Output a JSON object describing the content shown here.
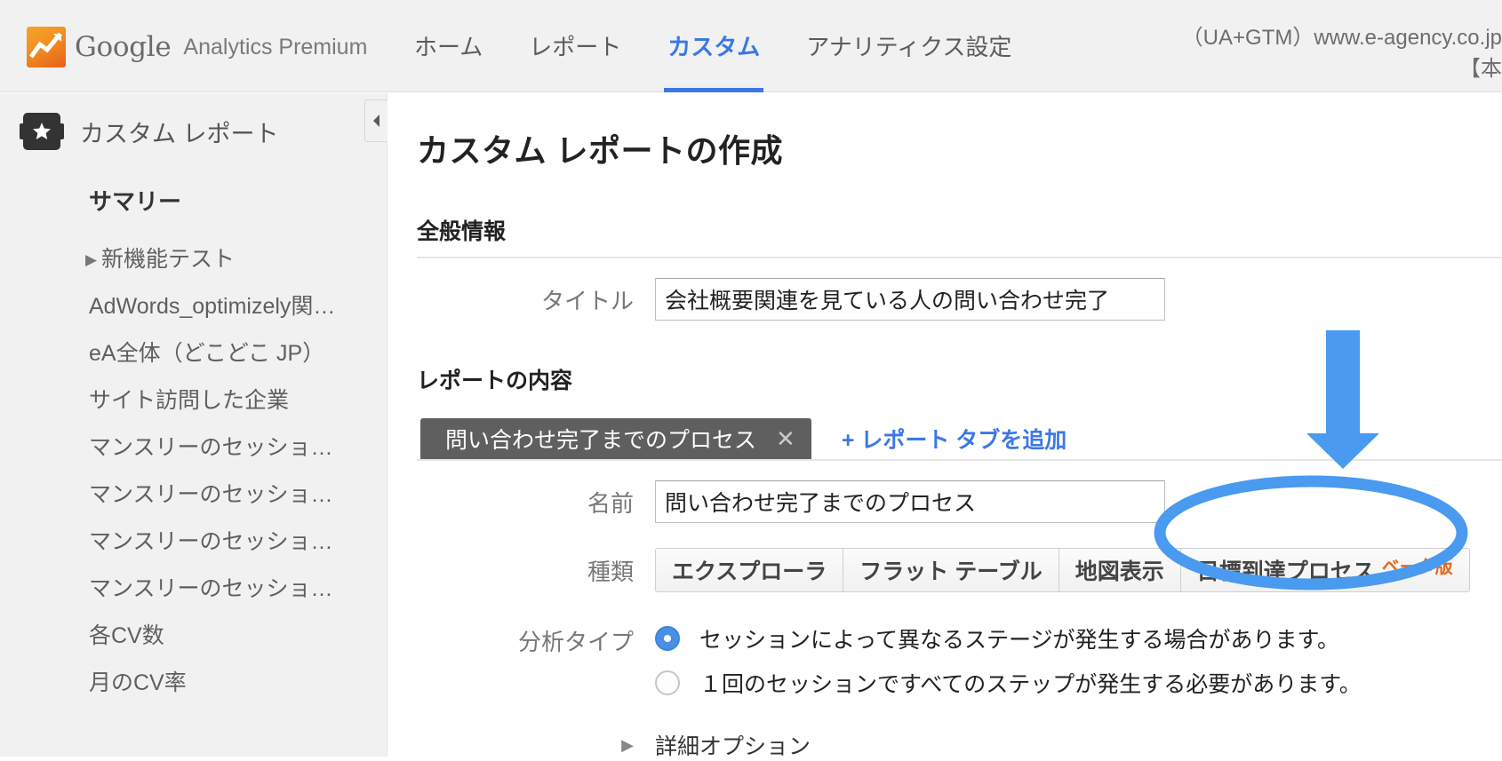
{
  "header": {
    "logo_word": "Google",
    "logo_sub": "Analytics Premium",
    "nav": [
      {
        "label": "ホーム",
        "active": false
      },
      {
        "label": "レポート",
        "active": false
      },
      {
        "label": "カスタム",
        "active": true
      },
      {
        "label": "アナリティクス設定",
        "active": false
      }
    ],
    "account_line1": "（UA+GTM）www.e-agency.co.jp",
    "account_line2": "【本"
  },
  "sidebar": {
    "title": "カスタム レポート",
    "summary_label": "サマリー",
    "items": [
      {
        "label": "新機能テスト",
        "caret": true
      },
      {
        "label": "AdWords_optimizely関…",
        "caret": false
      },
      {
        "label": "eA全体（どこどこ JP）",
        "caret": false
      },
      {
        "label": "サイト訪問した企業",
        "caret": false
      },
      {
        "label": "マンスリーのセッショ…",
        "caret": false
      },
      {
        "label": "マンスリーのセッショ…",
        "caret": false
      },
      {
        "label": "マンスリーのセッショ…",
        "caret": false
      },
      {
        "label": "マンスリーのセッショ…",
        "caret": false
      },
      {
        "label": "各CV数",
        "caret": false
      },
      {
        "label": "月のCV率",
        "caret": false
      }
    ]
  },
  "main": {
    "page_title": "カスタム レポートの作成",
    "general_section": {
      "heading": "全般情報",
      "title_label": "タイトル",
      "title_value": "会社概要関連を見ている人の問い合わせ完了",
      "title_placeholder": "タイトル"
    },
    "content_section": {
      "heading": "レポートの内容",
      "tab_label": "問い合わせ完了までのプロセス",
      "tab_close_glyph": "✕",
      "add_tab_label": "+ レポート タブを追加",
      "name_label": "名前",
      "name_value": "問い合わせ完了までのプロセス",
      "name_placeholder": "名前",
      "type_label": "種類",
      "type_buttons": [
        {
          "label": "エクスプローラ",
          "badge": ""
        },
        {
          "label": "フラット テーブル",
          "badge": ""
        },
        {
          "label": "地図表示",
          "badge": ""
        },
        {
          "label": "目標到達プロセス",
          "badge": "ベータ版"
        }
      ],
      "analysis_label": "分析タイプ",
      "analysis_options": [
        {
          "label": "セッションによって異なるステージが発生する場合があります。",
          "checked": true
        },
        {
          "label": "１回のセッションですべてのステップが発生する必要があります。",
          "checked": false
        }
      ],
      "advanced_label": "詳細オプション",
      "advanced_caret": "▶"
    }
  },
  "colors": {
    "accent_blue": "#3b78e7",
    "annotation_blue": "#4a9af0",
    "beta_orange": "#e8681f",
    "tab_gray": "#5f5f5f"
  }
}
